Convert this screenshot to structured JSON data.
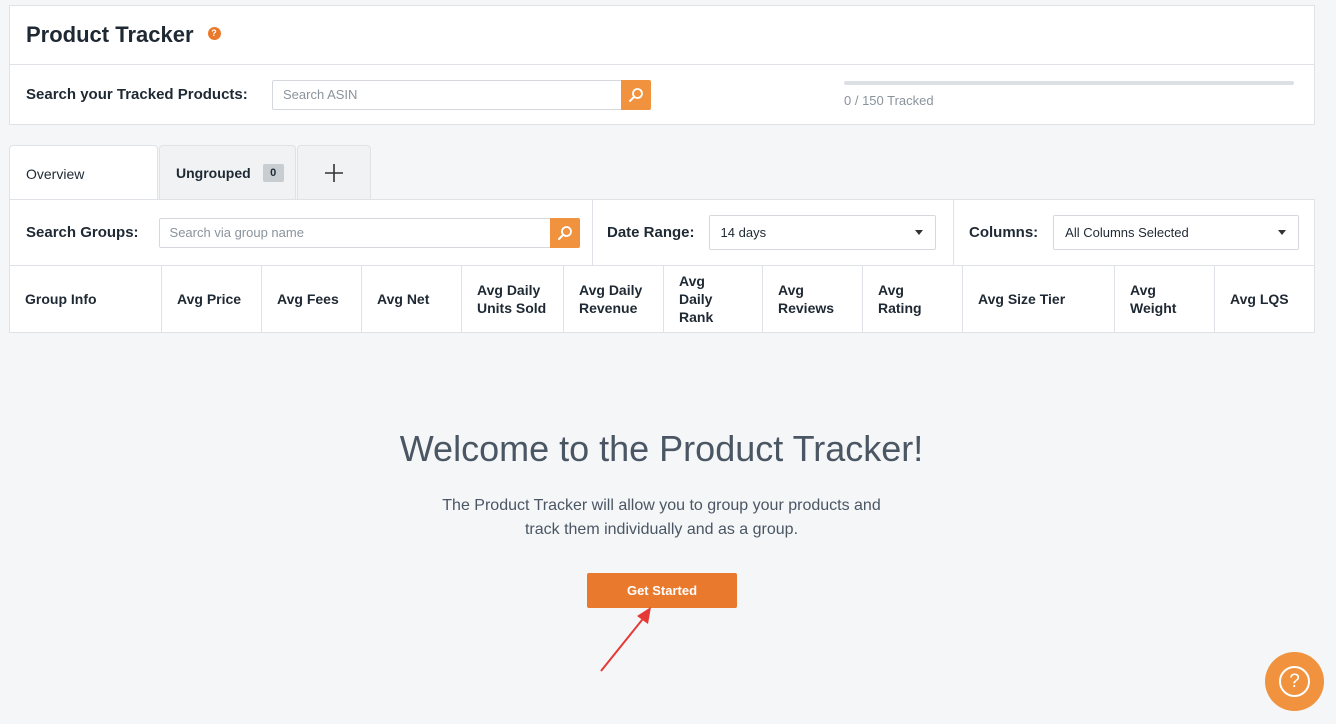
{
  "header": {
    "title": "Product Tracker",
    "help_glyph": "?"
  },
  "tracked_search": {
    "label": "Search your Tracked Products:",
    "placeholder": "Search ASIN",
    "value": "",
    "icon": "search-icon"
  },
  "tracking": {
    "tracked": 0,
    "limit": 150,
    "text": "0 / 150 Tracked",
    "fraction": 0
  },
  "tabs": {
    "overview": "Overview",
    "ungrouped": "Ungrouped",
    "ungrouped_count": "0",
    "add": "+"
  },
  "filters": {
    "groups_label": "Search Groups:",
    "groups_placeholder": "Search via group name",
    "date_label": "Date Range:",
    "date_value": "14 days",
    "columns_label": "Columns:",
    "columns_value": "All Columns Selected"
  },
  "table": {
    "columns": [
      "Group Info",
      "Avg Price",
      "Avg Fees",
      "Avg Net",
      "Avg Daily Units Sold",
      "Avg Daily Revenue",
      "Avg Daily Rank",
      "Avg Reviews",
      "Avg Rating",
      "Avg Size Tier",
      "Avg Weight",
      "Avg LQS"
    ]
  },
  "welcome": {
    "title": "Welcome to the Product Tracker!",
    "line1": "The Product Tracker will allow you to group your products and",
    "line2": "track them individually and as a group.",
    "button": "Get Started"
  },
  "help_fab": {
    "glyph": "?",
    "icon": "question-circle-icon"
  },
  "colors": {
    "accent": "#e8792d",
    "search_button": "#f0923e",
    "annotation_arrow": "#e53935"
  }
}
